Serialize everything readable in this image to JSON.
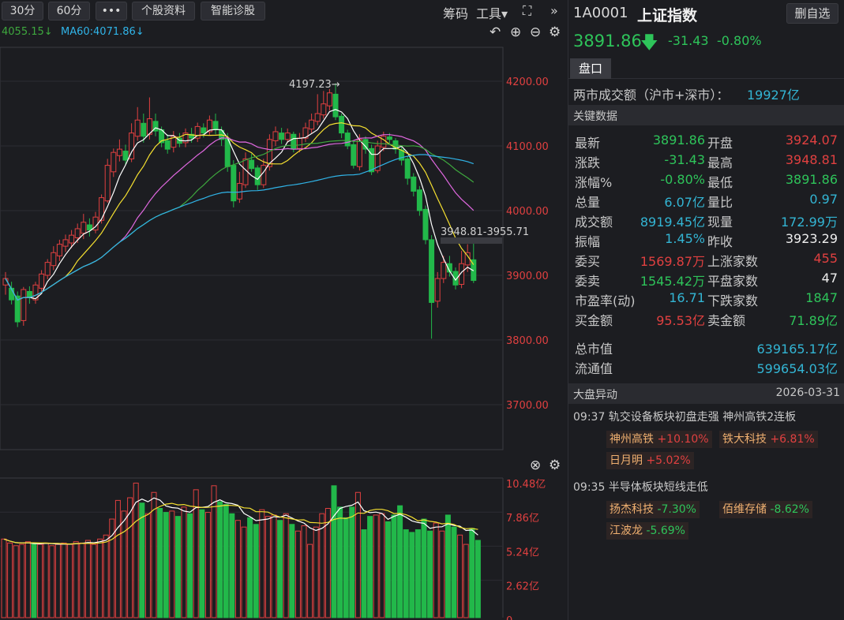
{
  "toolbar": {
    "periods": [
      "30分",
      "60分"
    ],
    "more": "•••",
    "profile": "个股资料",
    "diagnosis": "智能诊股",
    "chips": "筹码",
    "tools": "工具▾",
    "expand": "⛶",
    "collapse": "»"
  },
  "legend": {
    "ma_partial": "4055.15↓",
    "ma60": "MA60:4071.86↓"
  },
  "chart_data": [
    {
      "type": "candlestick",
      "title": "上证指数",
      "ylim": [
        3650,
        4250
      ],
      "ticks": [
        "4200.00",
        "4100.00",
        "4000.00",
        "3900.00",
        "3800.00",
        "3700.00"
      ],
      "annotations": {
        "high": "4197.23→",
        "range": "3948.81-3955.71"
      },
      "candles": [
        [
          3885,
          3895,
          3870,
          3905
        ],
        [
          3880,
          3862,
          3855,
          3890
        ],
        [
          3868,
          3828,
          3820,
          3875
        ],
        [
          3830,
          3878,
          3822,
          3882
        ],
        [
          3875,
          3866,
          3856,
          3883
        ],
        [
          3862,
          3885,
          3856,
          3890
        ],
        [
          3880,
          3902,
          3872,
          3908
        ],
        [
          3900,
          3920,
          3894,
          3925
        ],
        [
          3915,
          3935,
          3908,
          3945
        ],
        [
          3930,
          3948,
          3922,
          3955
        ],
        [
          3945,
          3955,
          3936,
          3963
        ],
        [
          3950,
          3962,
          3942,
          3970
        ],
        [
          3958,
          3972,
          3950,
          3980
        ],
        [
          3965,
          3982,
          3956,
          3995
        ],
        [
          3978,
          3970,
          3960,
          3988
        ],
        [
          3970,
          3990,
          3965,
          3998
        ],
        [
          3985,
          4020,
          3980,
          4025
        ],
        [
          4015,
          4070,
          4012,
          4080
        ],
        [
          4060,
          4090,
          4052,
          4096
        ],
        [
          4085,
          4095,
          4076,
          4110
        ],
        [
          4092,
          4078,
          4070,
          4102
        ],
        [
          4080,
          4120,
          4075,
          4135
        ],
        [
          4115,
          4140,
          4108,
          4160
        ],
        [
          4135,
          4115,
          4105,
          4150
        ],
        [
          4118,
          4142,
          4110,
          4175
        ],
        [
          4138,
          4123,
          4115,
          4150
        ],
        [
          4125,
          4105,
          4098,
          4130
        ],
        [
          4108,
          4095,
          4088,
          4118
        ],
        [
          4098,
          4115,
          4090,
          4123
        ],
        [
          4112,
          4104,
          4098,
          4120
        ],
        [
          4105,
          4120,
          4098,
          4127
        ],
        [
          4118,
          4112,
          4105,
          4128
        ],
        [
          4112,
          4130,
          4106,
          4136
        ],
        [
          4128,
          4120,
          4113,
          4135
        ],
        [
          4122,
          4140,
          4117,
          4147
        ],
        [
          4138,
          4125,
          4118,
          4150
        ],
        [
          4124,
          4110,
          4100,
          4130
        ],
        [
          4112,
          4068,
          4060,
          4120
        ],
        [
          4070,
          4015,
          4005,
          4078
        ],
        [
          4018,
          4042,
          4012,
          4060
        ],
        [
          4040,
          4080,
          4035,
          4090
        ],
        [
          4078,
          4065,
          4060,
          4088
        ],
        [
          4066,
          4040,
          4032,
          4070
        ],
        [
          4040,
          4070,
          4035,
          4080
        ],
        [
          4068,
          4110,
          4062,
          4118
        ],
        [
          4108,
          4122,
          4100,
          4130
        ],
        [
          4120,
          4110,
          4103,
          4128
        ],
        [
          4110,
          4120,
          4105,
          4127
        ],
        [
          4118,
          4095,
          4090,
          4122
        ],
        [
          4096,
          4112,
          4090,
          4120
        ],
        [
          4112,
          4128,
          4106,
          4136
        ],
        [
          4126,
          4140,
          4120,
          4150
        ],
        [
          4138,
          4150,
          4132,
          4180
        ],
        [
          4148,
          4165,
          4142,
          4185
        ],
        [
          4162,
          4182,
          4155,
          4188
        ],
        [
          4180,
          4145,
          4140,
          4197
        ],
        [
          4146,
          4120,
          4112,
          4150
        ],
        [
          4120,
          4100,
          4095,
          4125
        ],
        [
          4102,
          4070,
          4065,
          4108
        ],
        [
          4068,
          4110,
          4062,
          4118
        ],
        [
          4110,
          4095,
          4088,
          4115
        ],
        [
          4096,
          4060,
          4055,
          4102
        ],
        [
          4062,
          4100,
          4058,
          4108
        ],
        [
          4098,
          4115,
          4092,
          4122
        ],
        [
          4114,
          4110,
          4104,
          4120
        ],
        [
          4108,
          4095,
          4088,
          4112
        ],
        [
          4094,
          4078,
          4070,
          4100
        ],
        [
          4080,
          4050,
          4040,
          4085
        ],
        [
          4052,
          4030,
          4022,
          4058
        ],
        [
          4032,
          4000,
          3992,
          4038
        ],
        [
          4002,
          3955,
          3948,
          4008
        ],
        [
          3955,
          3858,
          3802,
          3962
        ],
        [
          3860,
          3895,
          3850,
          3905
        ],
        [
          3895,
          3920,
          3888,
          3930
        ],
        [
          3918,
          3905,
          3898,
          3930
        ],
        [
          3906,
          3885,
          3878,
          3912
        ],
        [
          3886,
          3918,
          3880,
          3938
        ],
        [
          3916,
          3935,
          3905,
          3948
        ],
        [
          3924,
          3892,
          3888,
          3949
        ]
      ]
    },
    {
      "type": "bar",
      "title": "成交额",
      "ticks": [
        "10.48亿",
        "7.86亿",
        "5.24亿",
        "2.62亿",
        "0"
      ],
      "ylim": [
        0,
        10.48
      ],
      "values": [
        5.9,
        5.6,
        5.4,
        5.5,
        5.7,
        5.6,
        5.5,
        5.6,
        5.4,
        5.5,
        5.6,
        5.5,
        5.7,
        5.6,
        5.8,
        5.5,
        5.9,
        6.2,
        7.4,
        8.8,
        8.0,
        9.0,
        10.1,
        8.6,
        7.8,
        9.4,
        8.2,
        7.9,
        8.0,
        7.6,
        8.3,
        7.8,
        9.6,
        8.1,
        7.9,
        9.9,
        8.7,
        8.5,
        7.8,
        7.3,
        6.8,
        7.5,
        7.0,
        8.1,
        7.6,
        7.7,
        7.3,
        7.8,
        7.0,
        6.5,
        6.9,
        5.5,
        6.8,
        7.8,
        8.2,
        9.9,
        8.3,
        7.5,
        8.3,
        9.4,
        6.6,
        7.6,
        7.7,
        7.8,
        7.2,
        7.7,
        8.4,
        6.6,
        6.4,
        6.6,
        7.4,
        6.5,
        7.1,
        6.5,
        7.7,
        6.8,
        6.2,
        5.5,
        6.7,
        5.8
      ],
      "dir": [
        0,
        0,
        0,
        0,
        0,
        1,
        0,
        0,
        0,
        0,
        0,
        0,
        0,
        0,
        0,
        0,
        0,
        0,
        0,
        0,
        0,
        0,
        0,
        1,
        0,
        0,
        1,
        1,
        0,
        1,
        0,
        1,
        0,
        1,
        0,
        0,
        1,
        1,
        1,
        0,
        0,
        1,
        1,
        0,
        0,
        0,
        1,
        0,
        1,
        0,
        0,
        0,
        0,
        0,
        0,
        1,
        1,
        1,
        1,
        0,
        1,
        1,
        0,
        0,
        1,
        1,
        1,
        1,
        1,
        1,
        1,
        1,
        0,
        0,
        1,
        1,
        0,
        0,
        1,
        1
      ]
    }
  ],
  "quote": {
    "code": "1A0001",
    "name": "上证指数",
    "edit": "删自选",
    "price": "3891.86",
    "arrow": "🡇",
    "change": "-31.43",
    "pct": "-0.80%"
  },
  "panel": {
    "tab": "盘口",
    "turnover_label": "两市成交额（沪市+深市）：",
    "turnover": "19927亿",
    "key_title": "关键数据",
    "rows": [
      {
        "l1": "最新",
        "v1": "3891.86",
        "c1": "green",
        "l2": "开盘",
        "v2": "3924.07",
        "c2": "red"
      },
      {
        "l1": "涨跌",
        "v1": "-31.43",
        "c1": "green",
        "l2": "最高",
        "v2": "3948.81",
        "c2": "red"
      },
      {
        "l1": "涨幅%",
        "v1": "-0.80%",
        "c1": "green",
        "l2": "最低",
        "v2": "3891.86",
        "c2": "green"
      },
      {
        "l1": "总量",
        "v1": "6.07亿",
        "c1": "cyan",
        "l2": "量比",
        "v2": "0.97",
        "c2": "cyan"
      },
      {
        "l1": "成交额",
        "v1": "8919.45亿",
        "c1": "cyan",
        "l2": "现量",
        "v2": "172.99万",
        "c2": "cyan"
      },
      {
        "l1": "振幅",
        "v1": "1.45%",
        "c1": "cyan",
        "l2": "昨收",
        "v2": "3923.29",
        "c2": "white"
      },
      {
        "l1": "委买",
        "v1": "1569.87万",
        "c1": "red",
        "l2": "上涨家数",
        "v2": "455",
        "c2": "red"
      },
      {
        "l1": "委卖",
        "v1": "1545.42万",
        "c1": "green",
        "l2": "平盘家数",
        "v2": "47",
        "c2": "white"
      },
      {
        "l1": "市盈率(动)",
        "v1": "16.71",
        "c1": "cyan",
        "l2": "下跌家数",
        "v2": "1847",
        "c2": "green"
      },
      {
        "l1": "买金额",
        "v1": "95.53亿",
        "c1": "red",
        "l2": "卖金额",
        "v2": "71.89亿",
        "c2": "green"
      }
    ],
    "mktcap_label": "总市值",
    "mktcap": "639165.17亿",
    "float_label": "流通值",
    "float": "599654.03亿"
  },
  "news": {
    "title": "大盘异动",
    "date": "2026-03-31",
    "events": [
      {
        "text": "09:37 轨交设备板块初盘走强 神州高铁2连板",
        "tags": [
          {
            "n": "神州高铁",
            "p": "+10.10%",
            "c": "red"
          },
          {
            "n": "铁大科技",
            "p": "+6.81%",
            "c": "red"
          },
          {
            "n": "日月明",
            "p": "+5.02%",
            "c": "red"
          }
        ]
      },
      {
        "text": "09:35 半导体板块短线走低",
        "tags": [
          {
            "n": "扬杰科技",
            "p": "-7.30%",
            "c": "green"
          },
          {
            "n": "佰维存储",
            "p": "-8.62%",
            "c": "green"
          },
          {
            "n": "江波龙",
            "p": "-5.69%",
            "c": "green"
          }
        ]
      }
    ]
  },
  "colors": {
    "up": "#e04040",
    "down": "#22b84a",
    "ma5": "#ffffff",
    "ma10": "#f5e030",
    "ma20": "#e068e0",
    "ma30": "#3ea83e",
    "ma60": "#30b4e8"
  }
}
